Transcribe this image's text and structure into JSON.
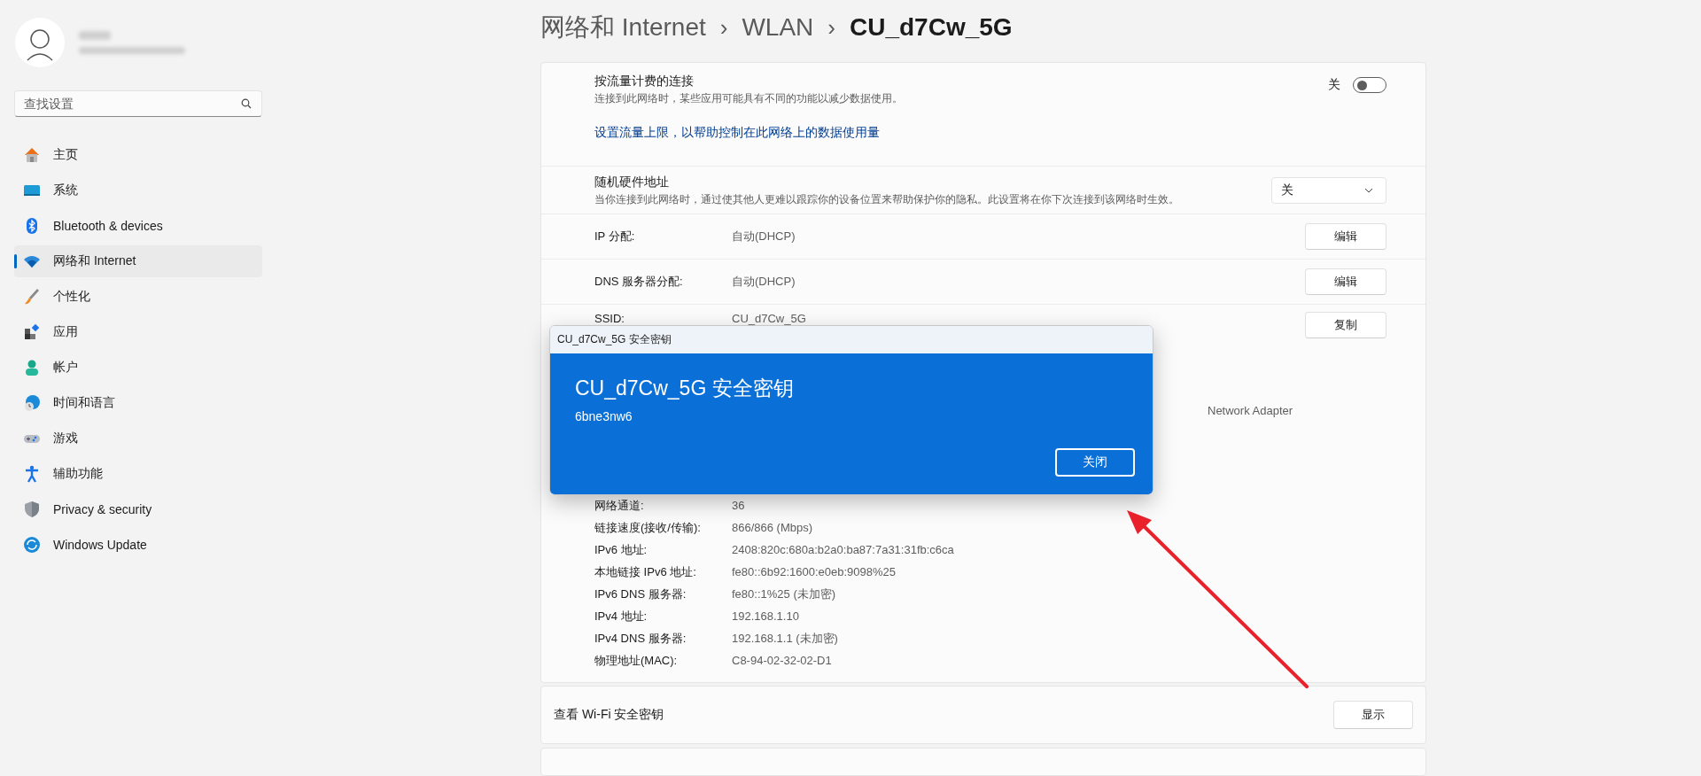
{
  "sidebar": {
    "search": {
      "placeholder": "查找设置"
    },
    "items": [
      {
        "label": "主页",
        "selected": false
      },
      {
        "label": "系统",
        "selected": false
      },
      {
        "label": "Bluetooth & devices",
        "selected": false
      },
      {
        "label": "网络和 Internet",
        "selected": true
      },
      {
        "label": "个性化",
        "selected": false
      },
      {
        "label": "应用",
        "selected": false
      },
      {
        "label": "帐户",
        "selected": false
      },
      {
        "label": "时间和语言",
        "selected": false
      },
      {
        "label": "游戏",
        "selected": false
      },
      {
        "label": "辅助功能",
        "selected": false
      },
      {
        "label": "Privacy & security",
        "selected": false
      },
      {
        "label": "Windows Update",
        "selected": false
      }
    ]
  },
  "breadcrumb": [
    {
      "text": "网络和 Internet"
    },
    {
      "text": "WLAN"
    },
    {
      "text": "CU_d7Cw_5G"
    }
  ],
  "breadcrumb_separator": "›",
  "metered": {
    "title": "按流量计费的连接",
    "description": "连接到此网络时，某些应用可能具有不同的功能以减少数据使用。",
    "toggle_label": "关",
    "on": false,
    "link": "设置流量上限，以帮助控制在此网络上的数据使用量"
  },
  "random_hardware_address": {
    "title": "随机硬件地址",
    "description": "当你连接到此网络时，通过使其他人更难以跟踪你的设备位置来帮助保护你的隐私。此设置将在你下次连接到该网络时生效。",
    "value": "关"
  },
  "rows": [
    {
      "label": "IP 分配:",
      "value": "自动(DHCP)",
      "button": "编辑"
    },
    {
      "label": "DNS 服务器分配:",
      "value": "自动(DHCP)",
      "button": "编辑"
    },
    {
      "label": "SSID:",
      "value": "CU_d7Cw_5G",
      "button": "复制"
    }
  ],
  "adapter_fragment": "Network Adapter",
  "details": [
    {
      "label": "网络通道:",
      "value": "36"
    },
    {
      "label": "链接速度(接收/传输):",
      "value": "866/866 (Mbps)"
    },
    {
      "label": "IPv6 地址:",
      "value": "2408:820c:680a:b2a0:ba87:7a31:31fb:c6ca"
    },
    {
      "label": "本地链接 IPv6 地址:",
      "value": "fe80::6b92:1600:e0eb:9098%25"
    },
    {
      "label": "IPv6 DNS 服务器:",
      "value": "fe80::1%25 (未加密)"
    },
    {
      "label": "IPv4 地址:",
      "value": "192.168.1.10"
    },
    {
      "label": "IPv4 DNS 服务器:",
      "value": "192.168.1.1 (未加密)"
    },
    {
      "label": "物理地址(MAC):",
      "value": "C8-94-02-32-02-D1"
    }
  ],
  "wifi_key_card": {
    "label": "查看 Wi-Fi 安全密钥",
    "button": "显示"
  },
  "dialog": {
    "title": "CU_d7Cw_5G 安全密钥",
    "heading": "CU_d7Cw_5G 安全密钥",
    "key": "6bne3nw6",
    "button": "关闭"
  }
}
